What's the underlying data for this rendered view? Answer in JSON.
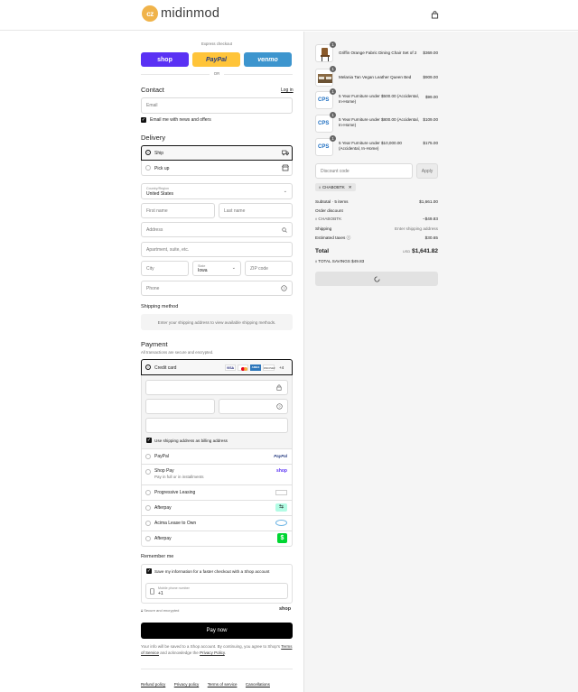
{
  "brand": {
    "logo_mark": "cz",
    "name": "midinmod"
  },
  "express": {
    "title": "Express checkout",
    "shop_label": "shop",
    "paypal_label": "PayPal",
    "venmo_label": "venmo",
    "or_label": "OR"
  },
  "contact": {
    "title": "Contact",
    "login_label": "Log in",
    "email_placeholder": "Email",
    "news_label": "Email me with news and offers"
  },
  "delivery": {
    "title": "Delivery",
    "ship_label": "Ship",
    "pickup_label": "Pick up",
    "country_label": "Country/Region",
    "country_value": "United States",
    "first_name": "First name",
    "last_name": "Last name",
    "address": "Address",
    "apartment": "Apartment, suite, etc.",
    "city": "City",
    "state_label": "State",
    "state_value": "Iowa",
    "zip": "ZIP code",
    "phone": "Phone"
  },
  "shipping_method": {
    "title": "Shipping method",
    "message": "Enter your shipping address to view available shipping methods."
  },
  "payment": {
    "title": "Payment",
    "subtitle": "All transactions are secure and encrypted.",
    "credit_card_label": "Credit card",
    "card_brands": [
      "VISA",
      "MC",
      "AMEX",
      "DISCOVER"
    ],
    "more_brands": "+4",
    "billing_label": "Use shipping address as billing address",
    "options": [
      {
        "label": "PayPal",
        "sub": "",
        "logo": "PayPal"
      },
      {
        "label": "Shop Pay",
        "sub": "Pay in full or in installments",
        "logo": "shop"
      },
      {
        "label": "Progressive Leasing",
        "sub": "",
        "logo": "progressive"
      },
      {
        "label": "Afterpay",
        "sub": "",
        "logo": "afterpay"
      },
      {
        "label": "Acima Lease to Own",
        "sub": "",
        "logo": "acima"
      },
      {
        "label": "Afterpay",
        "sub": "",
        "logo": "cashapp"
      }
    ]
  },
  "remember": {
    "title": "Remember me",
    "save_label": "Save my information for a faster checkout with a Shop account",
    "phone_label": "Mobile phone number",
    "phone_value": "+1",
    "secure_label": "Secure and encrypted",
    "shop_label": "shop"
  },
  "pay_now": "Pay now",
  "legal": {
    "text1": "Your info will be saved to a Shop account. By continuing, you agree to Shop's",
    "terms": "Terms of Service",
    "text2": "and acknowledge the",
    "privacy": "Privacy Policy",
    "end": "."
  },
  "footer_links": [
    "Refund policy",
    "Privacy policy",
    "Terms of service",
    "Cancellations"
  ],
  "order": {
    "items": [
      {
        "name": "Griffin Orange Fabric Dining Chair Set of 2",
        "qty": "1",
        "price": "$369.00",
        "thumb": "chair"
      },
      {
        "name": "Melania Tan Vegan Leather Queen Bed",
        "qty": "1",
        "price": "$909.00",
        "thumb": "bed"
      },
      {
        "name": "5 Year Furniture under $500.00 (Accidental, In-Home)",
        "qty": "1",
        "price": "$99.00",
        "thumb": "cps"
      },
      {
        "name": "5 Year Furniture under $800.00 (Accidental, In-Home)",
        "qty": "1",
        "price": "$109.00",
        "thumb": "cps"
      },
      {
        "name": "5 Year Furniture under $10,000.00 (Accidental, In-Home)",
        "qty": "1",
        "price": "$175.00",
        "thumb": "cps"
      }
    ],
    "discount_placeholder": "Discount code",
    "apply_label": "Apply",
    "code_tag": "CHABOBTK",
    "subtotal_label": "Subtotal · 5 items",
    "subtotal_value": "$1,661.00",
    "order_discount_label": "Order discount",
    "discount_code": "CHABOBTK",
    "discount_value": "−$49.83",
    "shipping_label": "Shipping",
    "shipping_value": "Enter shipping address",
    "taxes_label": "Estimated taxes",
    "taxes_value": "$30.65",
    "total_label": "Total",
    "currency": "USD",
    "total_value": "$1,641.82",
    "savings_label": "TOTAL SAVINGS",
    "savings_value": "$49.83"
  },
  "colors": {
    "shop": "#5a31f4",
    "paypal": "#ffc439",
    "venmo": "#3d95ce",
    "accent": "#000000"
  }
}
